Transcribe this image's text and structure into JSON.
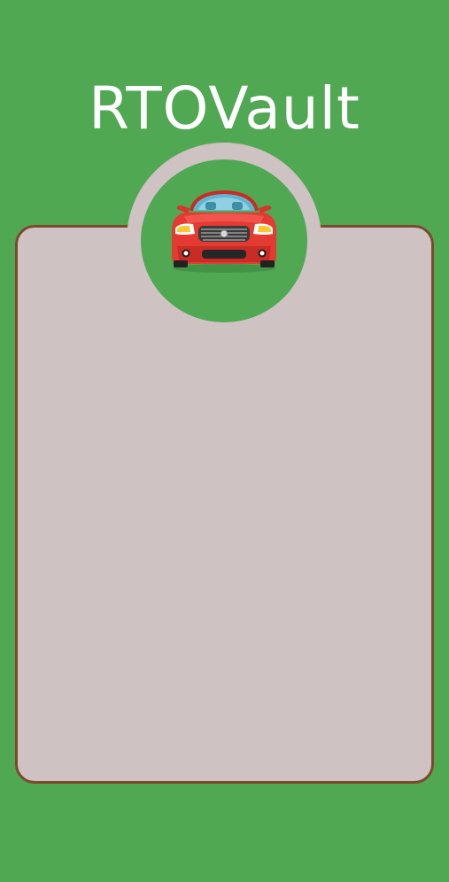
{
  "app": {
    "title": "RTOVault"
  },
  "logo": {
    "icon": "red-car-icon"
  },
  "colors": {
    "background": "#51a853",
    "card": "#cec2c3",
    "card_border": "#7b4a2c",
    "title_text": "#ffffff",
    "car_body": "#e53a32"
  }
}
